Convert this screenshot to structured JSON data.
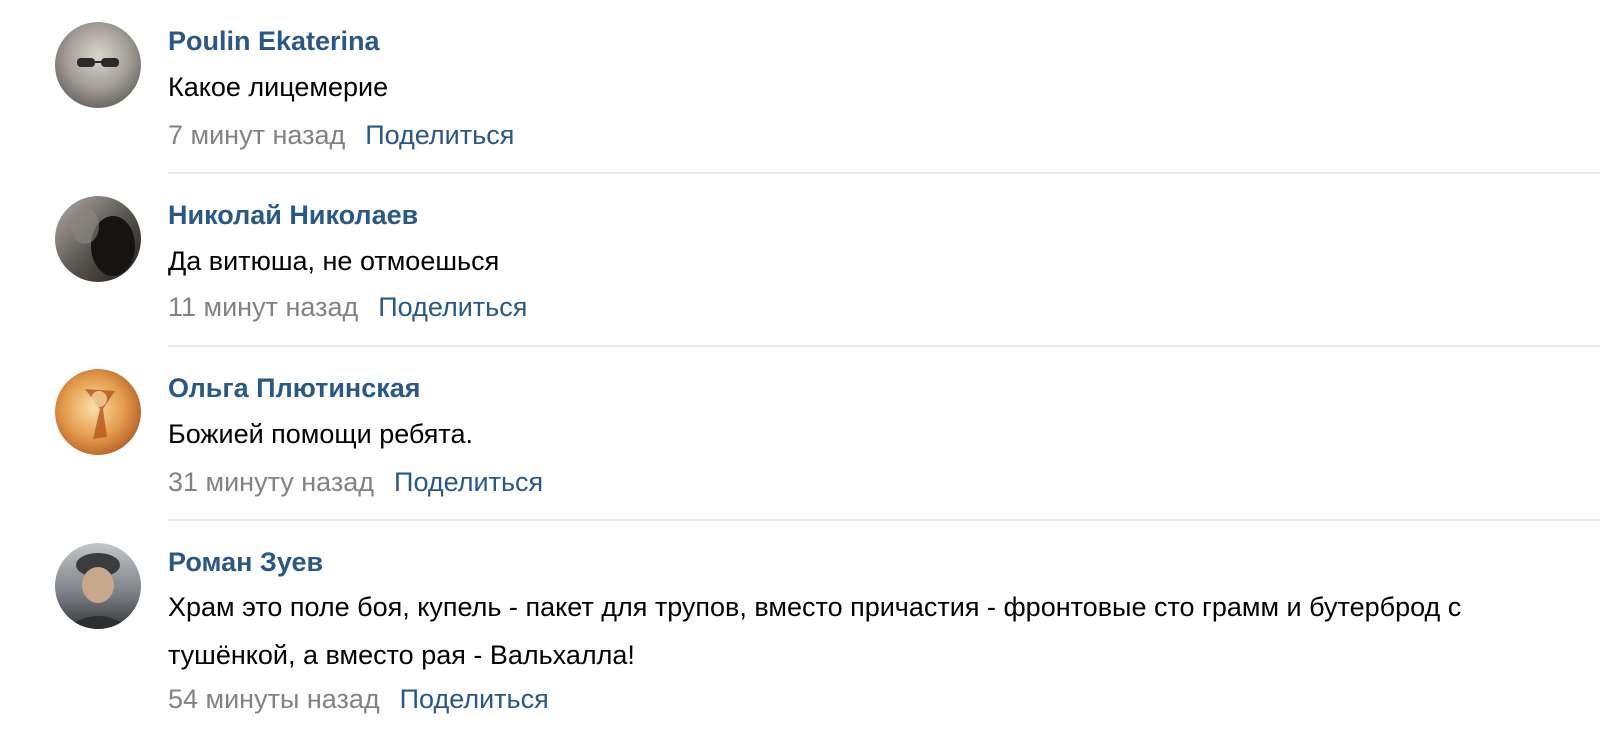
{
  "comments": [
    {
      "author": "Poulin Ekaterina",
      "text": "Какое лицемерие",
      "time": "7 минут назад",
      "share": "Поделиться",
      "avatar_colors": [
        "#c9c6c1",
        "#8f8b86",
        "#5a5653"
      ]
    },
    {
      "author": "Николай Николаев",
      "text": "Да витюша, не отмоешься",
      "time": "11 минут назад",
      "share": "Поделиться",
      "avatar_colors": [
        "#9a9590",
        "#4a4744",
        "#1f1d1c"
      ]
    },
    {
      "author": "Ольга Плютинская",
      "text": "Божией помощи ребята.",
      "time": "31 минуту назад",
      "share": "Поделиться",
      "avatar_colors": [
        "#f2c27a",
        "#d8873a",
        "#9c4a1c"
      ]
    },
    {
      "author": "Роман Зуев",
      "text": "Храм это поле боя, купель - пакет для трупов, вместо причастия - фронтовые сто грамм и бутерброд с тушёнкой, а вместо рая - Вальхалла!",
      "time": "54 минуты назад",
      "share": "Поделиться",
      "avatar_colors": [
        "#b8bcc0",
        "#6d7075",
        "#2e3033"
      ]
    }
  ],
  "colors": {
    "link": "#2a5885",
    "muted": "#828282",
    "divider": "#e7e8ec"
  }
}
